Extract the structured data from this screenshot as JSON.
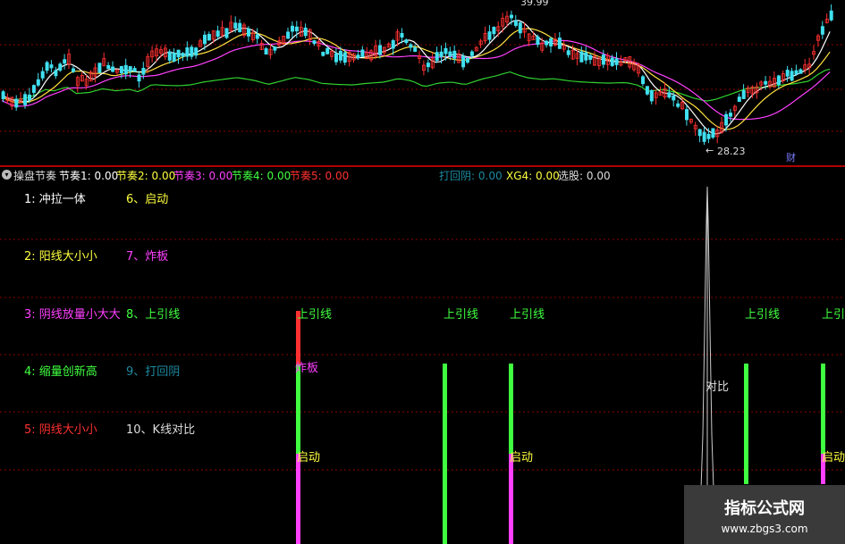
{
  "price_chart": {
    "high_label": "39.99",
    "low_label": "28.23",
    "low_arrow": "←",
    "finance_badge": "财",
    "colors": {
      "up": "#ff3030",
      "down": "#40e0f0",
      "ma5": "#ffffff",
      "ma10": "#ffe040",
      "ma20": "#ff40ff",
      "ma60": "#30d030"
    }
  },
  "status_bar": {
    "indicator_name": "操盘节奏",
    "items": [
      {
        "label": "节奏1:",
        "value": "0.00",
        "color": "#ffffff"
      },
      {
        "label": "节奏2:",
        "value": "0.00",
        "color": "#ffff40"
      },
      {
        "label": "节奏3:",
        "value": "0.00",
        "color": "#ff40ff"
      },
      {
        "label": "节奏4:",
        "value": "0.00",
        "color": "#40ff40"
      },
      {
        "label": "节奏5:",
        "value": "0.00",
        "color": "#ff3030"
      },
      {
        "label": "打回阴:",
        "value": "0.00",
        "color": "#1c8aa0"
      },
      {
        "label": "XG4:",
        "value": "0.00",
        "color": "#ffff40"
      },
      {
        "label": "选股:",
        "value": "0.00",
        "color": "#dddddd"
      }
    ]
  },
  "legend": {
    "left": [
      {
        "text": "1: 冲拉一体",
        "color": "#ffffff"
      },
      {
        "text": "2: 阳线大小小",
        "color": "#ffff40"
      },
      {
        "text": "3: 阴线放量小大大",
        "color": "#ff40ff"
      },
      {
        "text": "4: 缩量创新高",
        "color": "#40ff40"
      },
      {
        "text": "5: 阴线大小小",
        "color": "#ff3030"
      }
    ],
    "right": [
      {
        "text": "6、启动",
        "color": "#ffff40"
      },
      {
        "text": "7、炸板",
        "color": "#ff40ff"
      },
      {
        "text": "8、上引线",
        "color": "#40ff40"
      },
      {
        "text": "9、打回阴",
        "color": "#1c8aa0"
      },
      {
        "text": "10、K线对比",
        "color": "#dddddd"
      }
    ]
  },
  "signals": {
    "shangyinxian": "上引线",
    "zhaban": "炸板",
    "qidong": "启动",
    "duibi": "对比"
  },
  "watermark": {
    "title": "指标公式网",
    "url": "www.zbgs3.com"
  }
}
